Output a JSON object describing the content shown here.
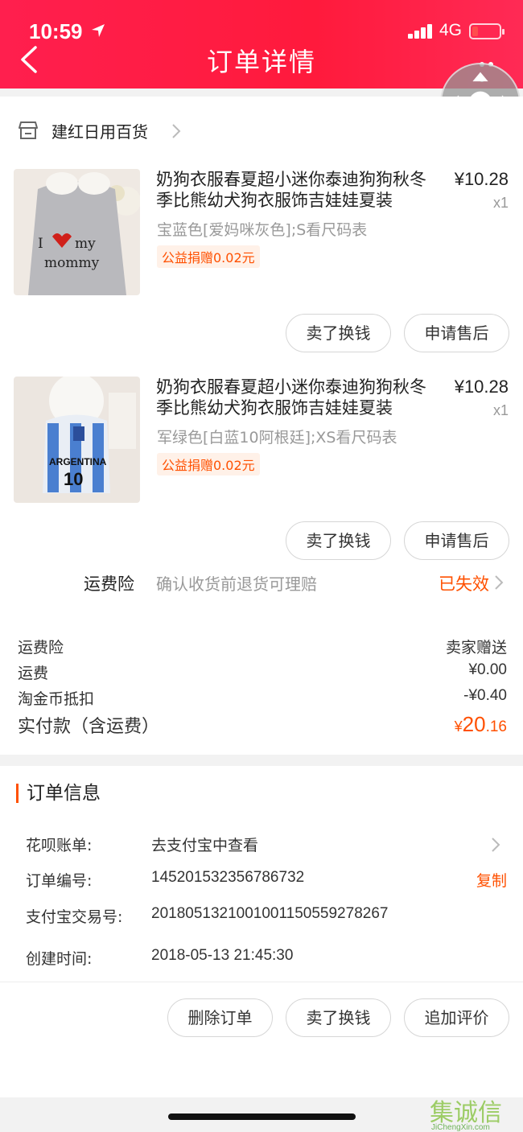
{
  "status_bar": {
    "time": "10:59",
    "network": "4G"
  },
  "header": {
    "title": "订单详情"
  },
  "shop": {
    "name": "建红日用百货"
  },
  "items": [
    {
      "title": "奶狗衣服春夏超小迷你泰迪狗狗秋冬季比熊幼犬狗衣服饰吉娃娃夏装",
      "price": "¥10.28",
      "qty": "x1",
      "sku": "宝蓝色[爱妈咪灰色];S看尺码表",
      "tag": "公益捐赠0.02元",
      "buttons": [
        "卖了换钱",
        "申请售后"
      ]
    },
    {
      "title": "奶狗衣服春夏超小迷你泰迪狗狗秋冬季比熊幼犬狗衣服饰吉娃娃夏装",
      "price": "¥10.28",
      "qty": "x1",
      "sku": "军绿色[白蓝10阿根廷];XS看尺码表",
      "tag": "公益捐赠0.02元",
      "buttons": [
        "卖了换钱",
        "申请售后"
      ]
    }
  ],
  "insurance": {
    "label": "运费险",
    "desc": "确认收货前退货可理赔",
    "status": "已失效"
  },
  "fees": [
    {
      "label": "运费险",
      "value": "卖家赠送"
    },
    {
      "label": "运费",
      "value": "¥0.00"
    },
    {
      "label": "淘金币抵扣",
      "value": "-¥0.40"
    }
  ],
  "total": {
    "label": "实付款（含运费）",
    "currency": "¥",
    "int": "20",
    "dec": ".16"
  },
  "order_info": {
    "title": "订单信息",
    "rows": [
      {
        "key": "花呗账单:",
        "value": "去支付宝中查看"
      },
      {
        "key": "订单编号:",
        "value": "145201532356786732",
        "action": "复制"
      },
      {
        "key": "支付宝交易号:",
        "value": "2018051321001001150559278267"
      },
      {
        "key": "创建时间:",
        "value": "2018-05-13 21:45:30"
      }
    ]
  },
  "bottom_buttons": [
    "删除订单",
    "卖了换钱",
    "追加评价"
  ],
  "watermark": {
    "main": "集诚信",
    "sub": "JiChengXin.com"
  },
  "colors": {
    "header": "#ff1f4e",
    "accent": "#ff5000"
  }
}
